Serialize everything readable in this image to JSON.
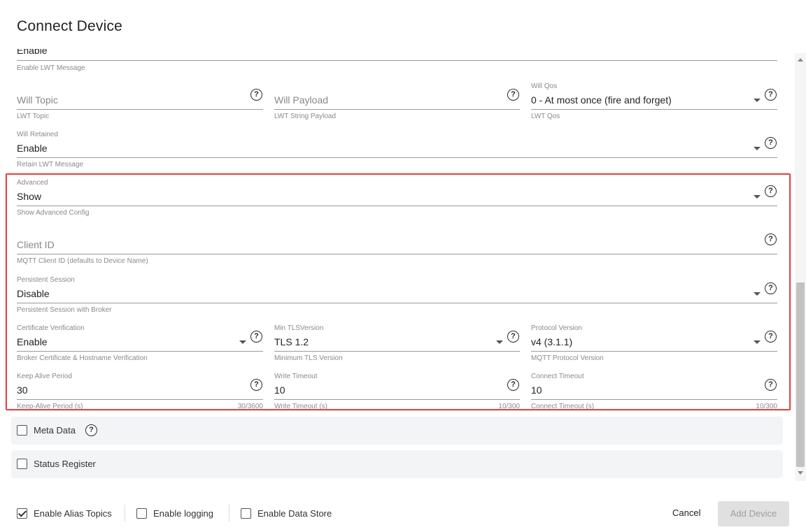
{
  "dialog": {
    "title": "Connect Device"
  },
  "fields": {
    "lwt_enable": {
      "value": "Enable",
      "helper": "Enable LWT Message"
    },
    "will_topic": {
      "placeholder": "Will Topic",
      "helper": "LWT Topic"
    },
    "will_payload": {
      "placeholder": "Will Payload",
      "helper": "LWT String Payload"
    },
    "will_qos": {
      "label": "Will Qos",
      "value": "0 - At most once (fire and forget)",
      "helper": "LWT Qos"
    },
    "will_retained": {
      "label": "Will Retained",
      "value": "Enable",
      "helper": "Retain LWT Message"
    },
    "advanced": {
      "label": "Advanced",
      "value": "Show",
      "helper": "Show Advanced Config"
    },
    "client_id": {
      "placeholder": "Client ID",
      "helper": "MQTT Client ID (defaults to Device Name)"
    },
    "persistent_session": {
      "label": "Persistent Session",
      "value": "Disable",
      "helper": "Persistent Session with Broker"
    },
    "cert_verification": {
      "label": "Certificate Verification",
      "value": "Enable",
      "helper": "Broker Certificate & Hostname Verification"
    },
    "min_tls": {
      "label": "Min TLSVersion",
      "value": "TLS 1.2",
      "helper": "Minimum TLS Version"
    },
    "protocol_version": {
      "label": "Protocol Version",
      "value": "v4 (3.1.1)",
      "helper": "MQTT Protocol Version"
    },
    "keep_alive": {
      "label": "Keep Alive Period",
      "value": "30",
      "helper": "Keep-Alive Period (s)",
      "counter": "30/3600"
    },
    "write_timeout": {
      "label": "Write Timeout",
      "value": "10",
      "helper": "Write Timeout (s)",
      "counter": "10/300"
    },
    "connect_timeout": {
      "label": "Connect Timeout",
      "value": "10",
      "helper": "Connect Timeout (s)",
      "counter": "10/300"
    }
  },
  "help_icon_glyph": "?",
  "panels": {
    "meta_data": {
      "label": "Meta Data",
      "checked": false
    },
    "status_register": {
      "label": "Status Register",
      "checked": false
    }
  },
  "footer": {
    "enable_alias_topics": {
      "label": "Enable Alias Topics",
      "checked": true
    },
    "enable_logging": {
      "label": "Enable logging",
      "checked": false
    },
    "enable_data_store": {
      "label": "Enable Data Store",
      "checked": false
    },
    "cancel_label": "Cancel",
    "add_device_label": "Add Device"
  },
  "colors": {
    "highlight_border": "#e04848",
    "disabled_button_bg": "#e0e0e0",
    "disabled_button_text": "#9e9e9e",
    "panel_bg": "#f3f4f6"
  }
}
